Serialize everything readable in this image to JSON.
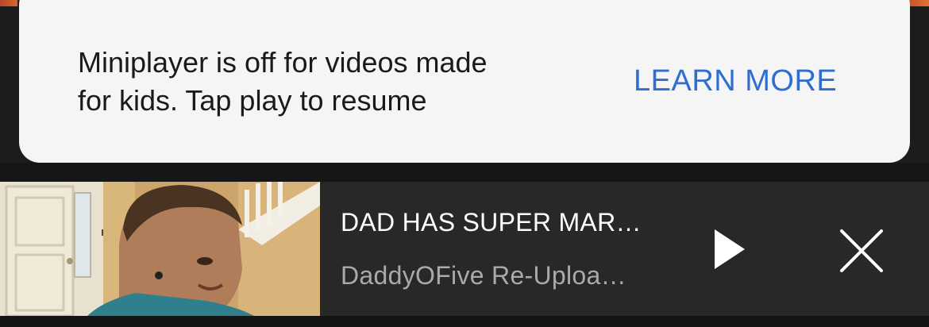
{
  "snackbar": {
    "message": "Miniplayer is off for videos made\nfor kids. Tap play to resume",
    "action_label": "LEARN MORE",
    "action_color": "#2f6dd1",
    "background_color": "#f5f5f5"
  },
  "miniplayer": {
    "thumbnail_icon": "video-thumbnail",
    "title": "DAD HAS SUPER MAR…",
    "channel": "DaddyOFive Re-Uploa…",
    "play_icon": "play-icon",
    "close_icon": "close-icon",
    "background_color": "#282828"
  }
}
